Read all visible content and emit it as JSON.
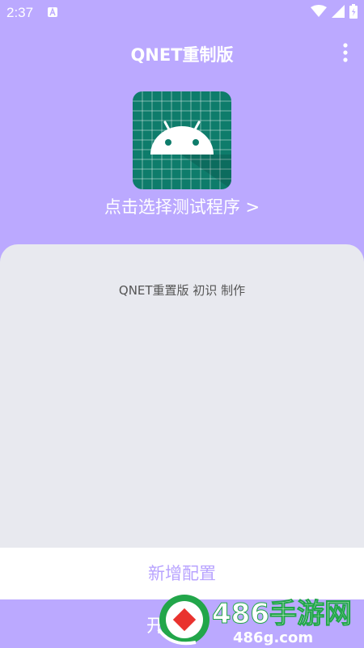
{
  "status_bar": {
    "time": "2:37",
    "icons": [
      "app-notification-icon",
      "wifi-icon",
      "signal-icon",
      "battery-icon"
    ]
  },
  "app_bar": {
    "title": "QNET重制版",
    "menu_icon": "more-vert-icon"
  },
  "main": {
    "app_icon": "android-app-icon",
    "select_label": "点击选择测试程序 >"
  },
  "panel": {
    "credit": "QNET重置版 初识 制作"
  },
  "actions": {
    "add_config_label": "新增配置",
    "start_label": "开"
  },
  "watermark": {
    "brand": "486手游网",
    "url": "486g.com"
  },
  "colors": {
    "accent": "#bba9ff",
    "panel_bg": "#e8e9ef",
    "icon_teal": "#0e7c6b",
    "button_text": "#b8a3ff"
  }
}
